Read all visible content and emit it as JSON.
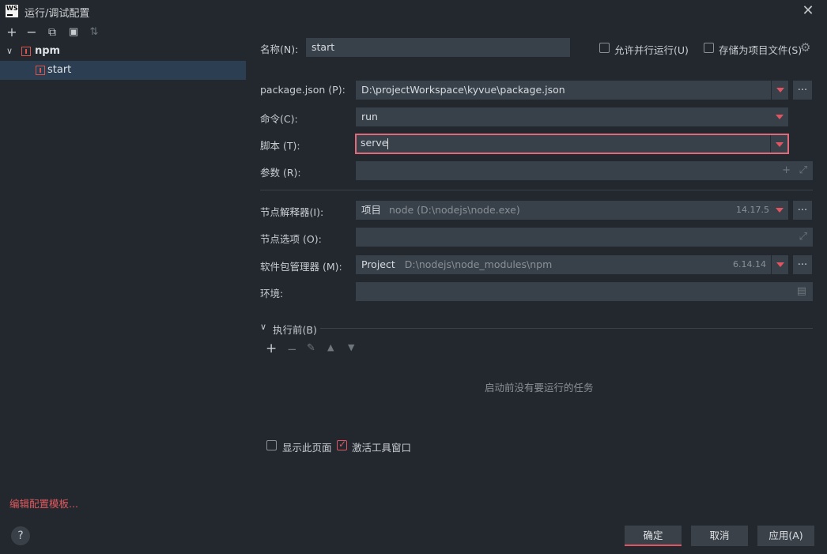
{
  "window": {
    "logo_text": "WS",
    "title": "运行/调试配置",
    "close_icon": "close-icon"
  },
  "toolbar": {
    "add": "+",
    "remove": "−",
    "copy": "⧉",
    "folder": "▣",
    "sort": "⇅"
  },
  "tree": {
    "group_label": "npm",
    "item_label": "start"
  },
  "footer": {
    "edit_templates": "编辑配置模板...",
    "help": "?",
    "ok": "确定",
    "cancel": "取消",
    "apply": "应用(A)"
  },
  "form": {
    "name_label": "名称(N):",
    "name_value": "start",
    "parallel_label": "允许并行运行(U)",
    "save_project_label": "存储为项目文件(S)",
    "package_json_label": "package.json (P):",
    "package_json_value": "D:\\projectWorkspace\\kyvue\\package.json",
    "command_label": "命令(C):",
    "command_value": "run",
    "script_label": "脚本 (T):",
    "script_value": "serve",
    "args_label": "参数 (R):",
    "args_value": "",
    "interpreter_label": "节点解释器(I):",
    "interpreter_prefix": "项目",
    "interpreter_path": "node (D:\\nodejs\\node.exe)",
    "interpreter_version": "14.17.5",
    "node_options_label": "节点选项 (O):",
    "node_options_value": "",
    "package_manager_label": "软件包管理器 (M):",
    "package_manager_prefix": "Project",
    "package_manager_path": "D:\\nodejs\\node_modules\\npm",
    "package_manager_version": "6.14.14",
    "env_label": "环境:",
    "env_value": "",
    "dots": "...",
    "before_launch_label": "执行前(B)",
    "before_launch_empty": "启动前没有要运行的任务",
    "show_page_label": "显示此页面",
    "activate_tool_label": "激活工具窗口"
  },
  "colors": {
    "background": "#23282e",
    "field": "#38414a",
    "accent": "#e05561",
    "selection": "#2c3e52"
  }
}
